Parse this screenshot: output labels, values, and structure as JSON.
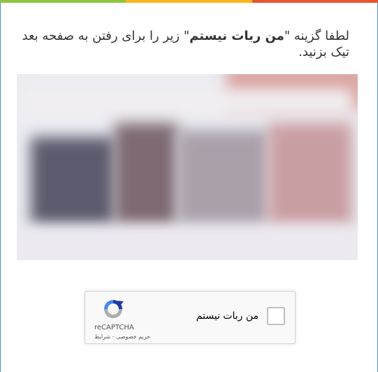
{
  "colors": {
    "topbar": [
      "#8cc63f",
      "#f9b51e",
      "#e8552a"
    ],
    "frame_border": "#4d8fdc",
    "recaptcha_logo": [
      "#1c3aa9",
      "#4285f4",
      "#abadad"
    ]
  },
  "message": {
    "before": "لطفا گزینه \"",
    "emphasis": "من ربات نیستم",
    "after": "\" زیر را برای رفتن به صفحه بعد تیک بزنید."
  },
  "recaptcha": {
    "checkbox_label": "من ربات نیستم",
    "checked": false,
    "brand": "reCAPTCHA",
    "terms": "حریم خصوصی - شرایط",
    "logo_icon": "recaptcha-logo-icon"
  }
}
